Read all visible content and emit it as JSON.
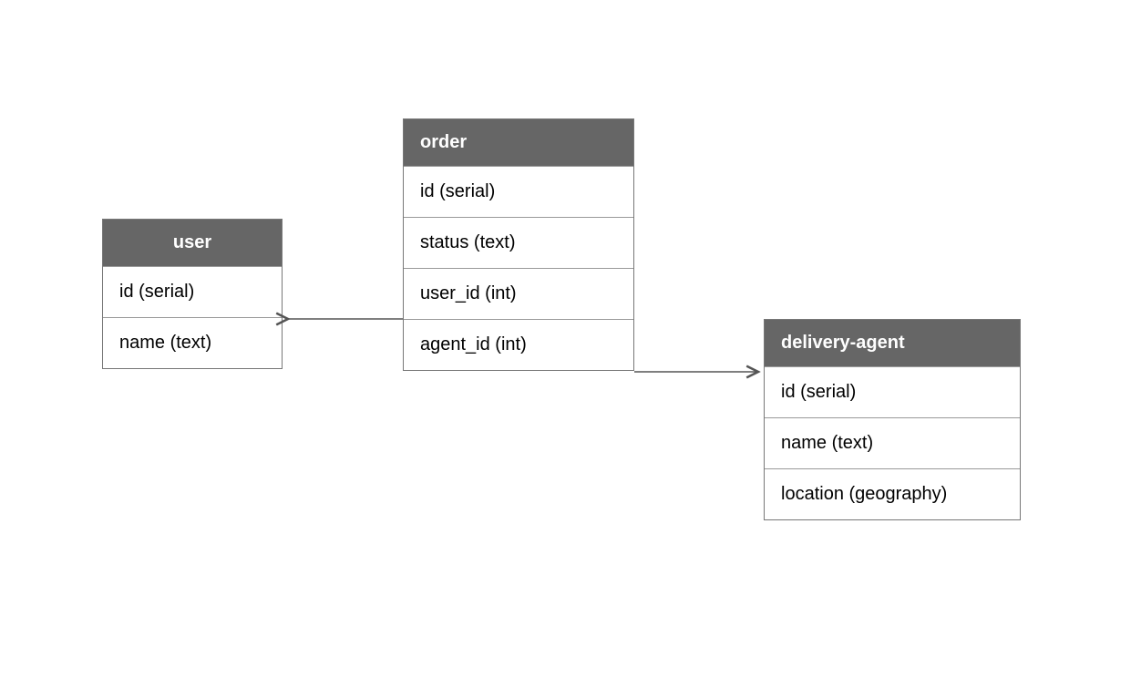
{
  "entities": {
    "user": {
      "title": "user",
      "fields": [
        "id (serial)",
        "name (text)"
      ]
    },
    "order": {
      "title": "order",
      "fields": [
        "id (serial)",
        "status (text)",
        "user_id (int)",
        "agent_id (int)"
      ]
    },
    "delivery_agent": {
      "title": "delivery-agent",
      "fields": [
        "id (serial)",
        "name (text)",
        "location (geography)"
      ]
    }
  },
  "relationships": [
    {
      "from_entity": "order",
      "from_field": "user_id",
      "to_entity": "user"
    },
    {
      "from_entity": "order",
      "from_field": "agent_id",
      "to_entity": "delivery_agent"
    }
  ],
  "colors": {
    "header_bg": "#666666",
    "header_text": "#ffffff",
    "border": "#777777",
    "arrow": "#555555"
  }
}
